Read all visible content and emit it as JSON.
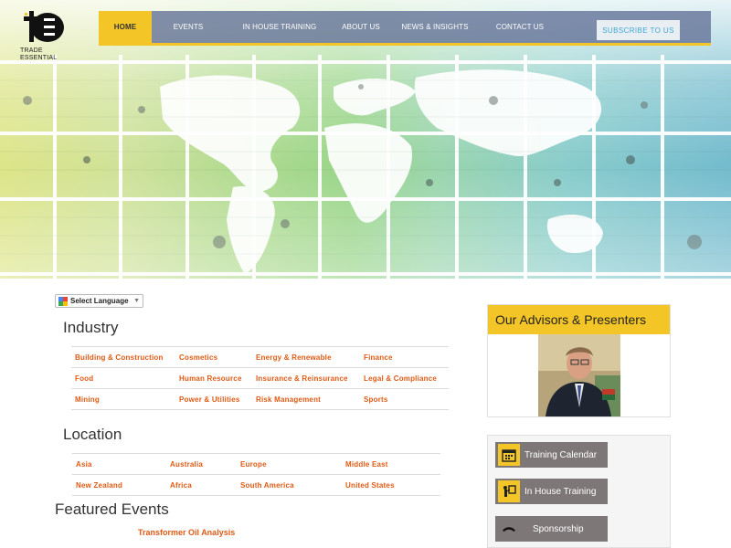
{
  "brand": {
    "line1": "TRADE",
    "line2": "ESSENTIAL"
  },
  "nav": {
    "items": [
      "HOME",
      "EVENTS",
      "IN HOUSE TRAINING",
      "ABOUT US",
      "NEWS & INSIGHTS",
      "CONTACT US"
    ],
    "subscribe": "SUBSCRIBE TO US"
  },
  "language": {
    "label": "Select Language",
    "arrow": "▼"
  },
  "industry": {
    "title": "Industry",
    "rows": [
      [
        "Building & Construction",
        "Cosmetics",
        "Energy & Renewable",
        "Finance"
      ],
      [
        "Food",
        "Human Resource",
        "Insurance & Reinsurance",
        "Legal & Compliance"
      ],
      [
        "Mining",
        "Power & Utilities",
        "Risk Management",
        "Sports"
      ]
    ]
  },
  "location": {
    "title": "Location",
    "rows": [
      [
        "Asia",
        "Australia",
        "Europe",
        "Middle East"
      ],
      [
        "New Zealand",
        "Africa",
        "South America",
        "United States"
      ]
    ]
  },
  "featured": {
    "title": "Featured Events",
    "link": "Transformer Oil Analysis"
  },
  "advisors": {
    "title": "Our Advisors & Presenters"
  },
  "sidebar_buttons": [
    {
      "label": "Training Calendar",
      "icon": "calendar-icon"
    },
    {
      "label": "In House Training",
      "icon": "presenter-icon"
    },
    {
      "label": "Sponsorship",
      "icon": "handshake-icon"
    }
  ],
  "colors": {
    "accent": "#f4c526",
    "link": "#e05a14",
    "nav": "#62709a",
    "button": "#7d7778"
  }
}
